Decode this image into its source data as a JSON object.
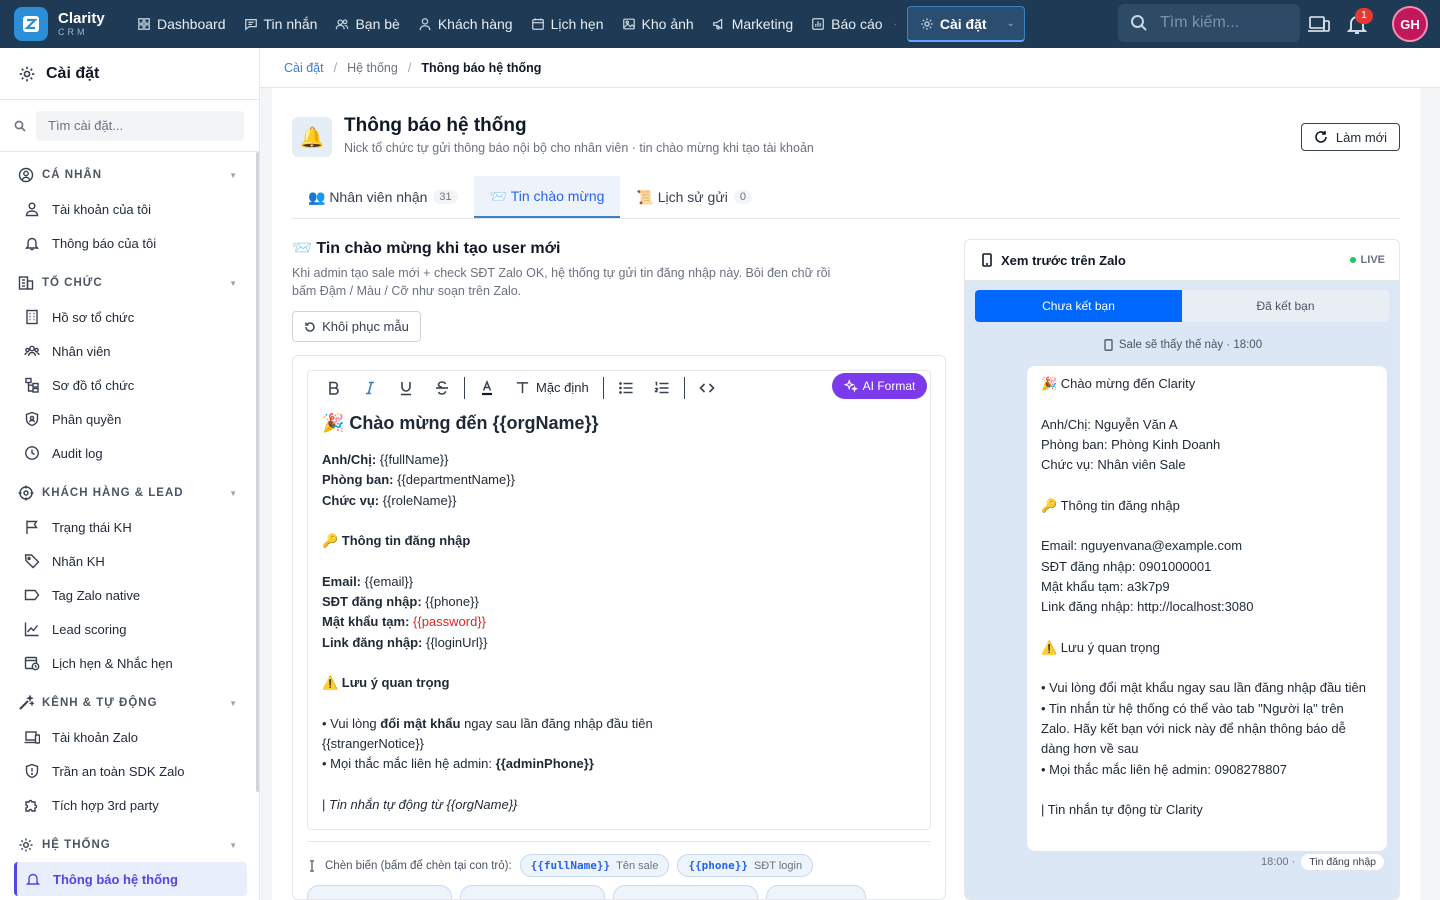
{
  "brand": {
    "name": "Clarity",
    "sub": "CRM"
  },
  "nav": {
    "items": [
      {
        "label": "Dashboard",
        "icon": "dashboard-icon"
      },
      {
        "label": "Tin nhắn",
        "icon": "message-icon"
      },
      {
        "label": "Bạn bè",
        "icon": "friends-icon"
      },
      {
        "label": "Khách hàng",
        "icon": "customer-icon"
      },
      {
        "label": "Lịch hẹn",
        "icon": "calendar-icon"
      },
      {
        "label": "Kho ảnh",
        "icon": "image-icon"
      },
      {
        "label": "Marketing",
        "icon": "megaphone-icon"
      },
      {
        "label": "Báo cáo",
        "icon": "chart-icon"
      }
    ],
    "active_label": "Cài đặt",
    "search_placeholder": "Tìm kiếm...",
    "notification_count": "1",
    "avatar_initials": "GH"
  },
  "sidebar": {
    "title": "Cài đặt",
    "search_placeholder": "Tìm cài đặt...",
    "sections": [
      {
        "title": "CÁ NHÂN",
        "items": [
          "Tài khoản của tôi",
          "Thông báo của tôi"
        ]
      },
      {
        "title": "TỔ CHỨC",
        "items": [
          "Hồ sơ tổ chức",
          "Nhân viên",
          "Sơ đồ tổ chức",
          "Phân quyền",
          "Audit log"
        ]
      },
      {
        "title": "KHÁCH HÀNG & LEAD",
        "items": [
          "Trạng thái KH",
          "Nhãn KH",
          "Tag Zalo native",
          "Lead scoring",
          "Lịch hẹn & Nhắc hẹn"
        ]
      },
      {
        "title": "KÊNH & TỰ ĐỘNG",
        "items": [
          "Tài khoản Zalo",
          "Trần an toàn SDK Zalo",
          "Tích hợp 3rd party"
        ]
      },
      {
        "title": "HỆ THỐNG",
        "items": [
          "Thông báo hệ thống"
        ]
      }
    ]
  },
  "breadcrumb": {
    "root": "Cài đặt",
    "mid": "Hệ thống",
    "current": "Thông báo hệ thống"
  },
  "header": {
    "title": "Thông báo hệ thống",
    "subtitle": "Nick tổ chức tự gửi thông báo nội bộ cho nhân viên · tin chào mừng khi tạo tài khoản",
    "refresh_label": "Làm mới"
  },
  "tabs": [
    {
      "label": "👥 Nhân viên nhận",
      "count": "31"
    },
    {
      "label": "📨 Tin chào mừng",
      "count": ""
    },
    {
      "label": "📜 Lịch sử gửi",
      "count": "0"
    }
  ],
  "welcome": {
    "title": "📨 Tin chào mừng khi tạo user mới",
    "desc": "Khi admin tạo sale mới + check SĐT Zalo OK, hệ thống tự gửi tin đăng nhập này. Bôi đen chữ rồi bấm Đậm / Màu / Cỡ như soạn trên Zalo.",
    "restore_label": "Khôi phục mẫu"
  },
  "editor": {
    "font_default": "Mặc định",
    "ai_label": "AI Format",
    "heading": "🎉 Chào mừng đến {{orgName}}",
    "lines": {
      "name_label": "Anh/Chị:",
      "name_var": " {{fullName}}",
      "dept_label": "Phòng ban:",
      "dept_var": " {{departmentName}}",
      "role_label": "Chức vụ:",
      "role_var": " {{roleName}}",
      "login_head": "🔑 Thông tin đăng nhập",
      "email_label": "Email:",
      "email_var": " {{email}}",
      "phone_label": "SĐT đăng nhập:",
      "phone_var": " {{phone}}",
      "pass_label": "Mật khẩu tạm:",
      "pass_var": " {{password}}",
      "link_label": "Link đăng nhập:",
      "link_var": " {{loginUrl}}",
      "note_head": "⚠️ Lưu ý quan trọng",
      "note1_pre": "• Vui lòng ",
      "note1_bold": "đổi mật khẩu",
      "note1_post": " ngay sau lần đăng nhập đầu tiên",
      "stranger": "{{strangerNotice}}",
      "admin_pre": "• Mọi thắc mắc liên hệ admin: ",
      "admin_var": "{{adminPhone}}",
      "footer_pre": "| ",
      "footer_it": "Tin nhắn tự động từ {{orgName}}"
    },
    "chips_label": "Chèn biến (bấm để chèn tại con trỏ):",
    "chips": [
      {
        "code": "{{fullName}}",
        "desc": "Tên sale"
      },
      {
        "code": "{{phone}}",
        "desc": "SĐT login"
      }
    ]
  },
  "preview": {
    "title": "Xem trước trên Zalo",
    "live": "LIVE",
    "toggle_on": "Chưa kết bạn",
    "toggle_off": "Đã kết bạn",
    "note": "Sale sẽ thấy thế này · 18:00",
    "lines": [
      "🎉 Chào mừng đến Clarity",
      "",
      "Anh/Chị: Nguyễn Văn A",
      "Phòng ban: Phòng Kinh Doanh",
      "Chức vụ: Nhân viên Sale",
      "",
      "🔑 Thông tin đăng nhập",
      "",
      "Email: nguyenvana@example.com",
      "SĐT đăng nhập: 0901000001",
      "Mật khẩu tạm: a3k7p9",
      "Link đăng nhập: http://localhost:3080",
      "",
      "⚠️ Lưu ý quan trọng",
      "",
      "• Vui lòng đổi mật khẩu ngay sau lần đăng nhập đầu tiên",
      "• Tin nhắn từ hệ thống có thể vào tab \"Người lạ\" trên Zalo. Hãy kết bạn với nick này để nhận thông báo dễ dàng hơn về sau",
      "• Mọi thắc mắc liên hệ admin: 0908278807",
      "",
      "| Tin nhắn tự động từ Clarity"
    ],
    "time": "18:00 ·",
    "tag": "Tin đăng nhập"
  },
  "colors": {
    "topbar": "#1e3a55",
    "accent": "#2563eb",
    "zalo_blue": "#0068ff",
    "ai_purple": "#7c3aed"
  }
}
